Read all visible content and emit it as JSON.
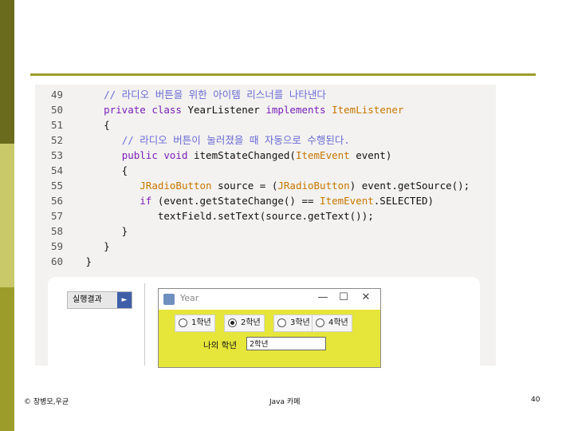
{
  "code": {
    "lines": [
      {
        "n": "49",
        "parts": [
          {
            "t": "    ",
            "c": "pl"
          },
          {
            "t": "// 라디오 버튼을 위한 아이템 리스너를 나타낸다",
            "c": "cmt"
          }
        ]
      },
      {
        "n": "50",
        "parts": [
          {
            "t": "    ",
            "c": "pl"
          },
          {
            "t": "private class ",
            "c": "kw"
          },
          {
            "t": "YearListener ",
            "c": "pl"
          },
          {
            "t": "implements ",
            "c": "kw"
          },
          {
            "t": "ItemListener",
            "c": "ty"
          }
        ]
      },
      {
        "n": "51",
        "parts": [
          {
            "t": "    {",
            "c": "pl"
          }
        ]
      },
      {
        "n": "52",
        "parts": [
          {
            "t": "       ",
            "c": "pl"
          },
          {
            "t": "// 라디오 버튼이 눌러졌을 때 자동으로 수행된다.",
            "c": "cmt"
          }
        ]
      },
      {
        "n": "53",
        "parts": [
          {
            "t": "       ",
            "c": "pl"
          },
          {
            "t": "public void ",
            "c": "kw"
          },
          {
            "t": "itemStateChanged(",
            "c": "pl"
          },
          {
            "t": "ItemEvent",
            "c": "ty"
          },
          {
            "t": " event)",
            "c": "pl"
          }
        ]
      },
      {
        "n": "54",
        "parts": [
          {
            "t": "       {",
            "c": "pl"
          }
        ]
      },
      {
        "n": "55",
        "parts": [
          {
            "t": "          ",
            "c": "pl"
          },
          {
            "t": "JRadioButton",
            "c": "ty"
          },
          {
            "t": " source = (",
            "c": "pl"
          },
          {
            "t": "JRadioButton",
            "c": "ty"
          },
          {
            "t": ") event.getSource();",
            "c": "pl"
          }
        ]
      },
      {
        "n": "56",
        "parts": [
          {
            "t": "          ",
            "c": "pl"
          },
          {
            "t": "if ",
            "c": "kw"
          },
          {
            "t": "(event.getStateChange() == ",
            "c": "pl"
          },
          {
            "t": "ItemEvent",
            "c": "ty"
          },
          {
            "t": ".SELECTED)",
            "c": "pl"
          }
        ]
      },
      {
        "n": "57",
        "parts": [
          {
            "t": "             textField.setText(source.getText());",
            "c": "pl"
          }
        ]
      },
      {
        "n": "58",
        "parts": [
          {
            "t": "       }",
            "c": "pl"
          }
        ]
      },
      {
        "n": "59",
        "parts": [
          {
            "t": "    }",
            "c": "pl"
          }
        ]
      },
      {
        "n": "60",
        "parts": [
          {
            "t": " }",
            "c": "pl"
          }
        ]
      }
    ]
  },
  "run_button": {
    "label": "실행결과",
    "arrow": "►"
  },
  "window": {
    "title": "Year",
    "minimize": "—",
    "maximize": "☐",
    "close": "✕",
    "radios": [
      {
        "label": "1학년",
        "selected": false
      },
      {
        "label": "2학년",
        "selected": true
      },
      {
        "label": "3학년",
        "selected": false
      },
      {
        "label": "4학년",
        "selected": false
      }
    ],
    "grade_label": "나의 학년",
    "grade_value": "2학년"
  },
  "footer": {
    "left": "© 창병모,우균",
    "center": "Java 카페",
    "page": "40"
  },
  "colors": {
    "comment": "#6b6bd6",
    "keyword": "#7a1fb8",
    "type": "#c77700",
    "panel_yellow": "#e6e63a"
  }
}
